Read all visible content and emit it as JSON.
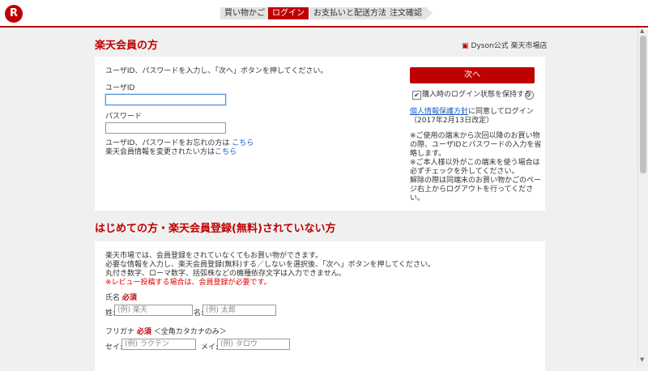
{
  "header": {
    "logo": "R",
    "steps": [
      {
        "label": "買い物かご",
        "active": false
      },
      {
        "label": "ログイン",
        "active": true
      },
      {
        "label": "お支払いと配送方法",
        "active": false
      },
      {
        "label": "注文確認",
        "active": false
      }
    ]
  },
  "shop": {
    "name": "Dyson公式 楽天市場店"
  },
  "member": {
    "title": "楽天会員の方",
    "instruction": "ユーザID、パスワードを入力し、「次へ」ボタンを押してください。",
    "userid_label": "ユーザID",
    "userid_value": "",
    "password_label": "パスワード",
    "password_value": "",
    "forgot_text": "ユーザID、パスワードをお忘れの方は",
    "forgot_link": "こちら",
    "change_text": "楽天会員情報を変更されたい方は",
    "change_link": "こちら",
    "next_button": "次へ",
    "keep_login_label": "購入時のログイン状態を保持する",
    "keep_login_checked": true,
    "privacy_link": "個人情報保護方針",
    "privacy_suffix": "に同意してログイン",
    "privacy_date": "（2017年2月13日改定）",
    "notes": [
      "※ご使用の端末から次回以降のお買い物",
      "の際、ユーザIDとパスワードの入力を省",
      "略します。",
      "※ご本人様以外がこの端末を使う場合は",
      "必ずチェックを外してください。",
      "解除の際は同端末のお買い物かごのペー",
      "ジ右上からログアウトを行ってくださ",
      "い。"
    ]
  },
  "guest": {
    "title": "はじめての方・楽天会員登録(無料)されていない方",
    "intro": [
      "楽天市場では、会員登録をされていなくてもお買い物ができます。",
      "必要な情報を入力し、楽天会員登録(無料)する／しないを選択後、「次へ」ボタンを押してください。",
      "丸付き数字、ローマ数字、括弧株などの機種依存文字は入力できません。"
    ],
    "review_note": "※レビュー投稿する場合は、会員登録が必要です。",
    "name_label": "氏名",
    "required": "必須",
    "last_name_label": "姓:",
    "last_name_placeholder": "(例) 楽天",
    "first_name_label": "名:",
    "first_name_placeholder": "(例) 太郎",
    "kana_label": "フリガナ",
    "kana_hint": "＜全角カタカナのみ＞",
    "sei_label": "セイ:",
    "sei_placeholder": "(例) ラクテン",
    "mei_label": "メイ:",
    "mei_placeholder": "(例) タロウ"
  },
  "colors": {
    "accent": "#bf0000",
    "link": "#1a5dc4"
  }
}
